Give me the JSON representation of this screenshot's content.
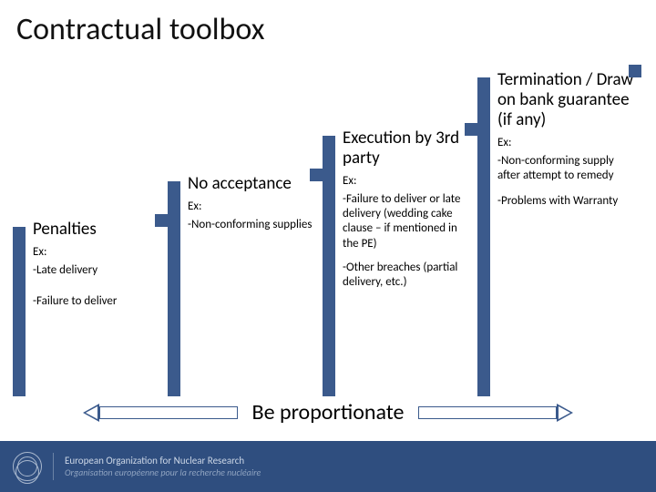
{
  "title": "Contractual toolbox",
  "steps": [
    {
      "heading": "Penalties",
      "ex_label": "Ex:",
      "line1": "-Late delivery",
      "line2": "-Failure to deliver"
    },
    {
      "heading": "No acceptance",
      "ex_label": "Ex:",
      "line1": "-Non-conforming supplies"
    },
    {
      "heading": "Execution by 3rd party",
      "ex_label": "Ex:",
      "line1": "-Failure to deliver or late delivery (wedding cake clause – if mentioned in the PE)",
      "line2": "-Other breaches (partial delivery, etc.)"
    },
    {
      "heading": "Termination / Draw on bank guarantee (if any)",
      "ex_label": "Ex:",
      "line1": "-Non-conforming supply after attempt to remedy",
      "line2": "-Problems with Warranty"
    }
  ],
  "proportionate": "Be proportionate",
  "footer": {
    "org_en": "European Organization for Nuclear Research",
    "org_fr": "Organisation européenne pour la recherche nucléaire"
  }
}
